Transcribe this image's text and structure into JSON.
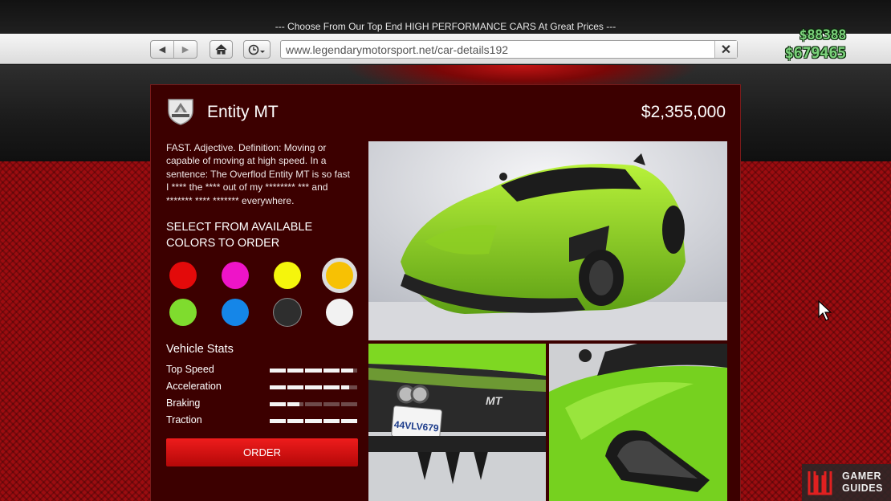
{
  "banner": {
    "text": "--- Choose From Our Top End HIGH PERFORMANCE CARS At Great Prices ---"
  },
  "browser": {
    "back_icon": "back-arrow-icon",
    "forward_icon": "forward-arrow-icon",
    "home_icon": "home-icon",
    "history_icon": "clock-icon",
    "url": "www.legendarymotorsport.net/car-details192",
    "close_icon": "close-icon"
  },
  "hud": {
    "cash": "$88388",
    "bank": "$679465"
  },
  "vehicle": {
    "brand_logo": "OVERFLOD",
    "name": "Entity MT",
    "price": "$2,355,000",
    "description": "FAST. Adjective. Definition: Moving or capable of moving at high speed. In a sentence: The Overflod Entity MT is so fast I **** the **** out of my ******** *** and ******* **** ******* everywhere.",
    "rear_plate": "44VLV679"
  },
  "colors": {
    "heading": "SELECT FROM AVAILABLE COLORS TO ORDER",
    "swatches": [
      {
        "name": "red",
        "hex": "#e30a0a"
      },
      {
        "name": "magenta",
        "hex": "#ee14c8"
      },
      {
        "name": "yellow",
        "hex": "#f5f50c"
      },
      {
        "name": "orange-yellow",
        "hex": "#f7c104",
        "selected": true
      },
      {
        "name": "lime",
        "hex": "#7fdc2e"
      },
      {
        "name": "blue",
        "hex": "#1586e8"
      },
      {
        "name": "charcoal",
        "hex": "#2e2e2e"
      },
      {
        "name": "white",
        "hex": "#f2f2f2"
      }
    ]
  },
  "stats": {
    "heading": "Vehicle Stats",
    "items": [
      {
        "label": "Top Speed",
        "level": 0.95
      },
      {
        "label": "Acceleration",
        "level": 0.9
      },
      {
        "label": "Braking",
        "level": 0.35
      },
      {
        "label": "Traction",
        "level": 1.0
      }
    ]
  },
  "order": {
    "label": "ORDER"
  },
  "watermark": {
    "line1": "GAMER",
    "line2": "GUIDES"
  }
}
